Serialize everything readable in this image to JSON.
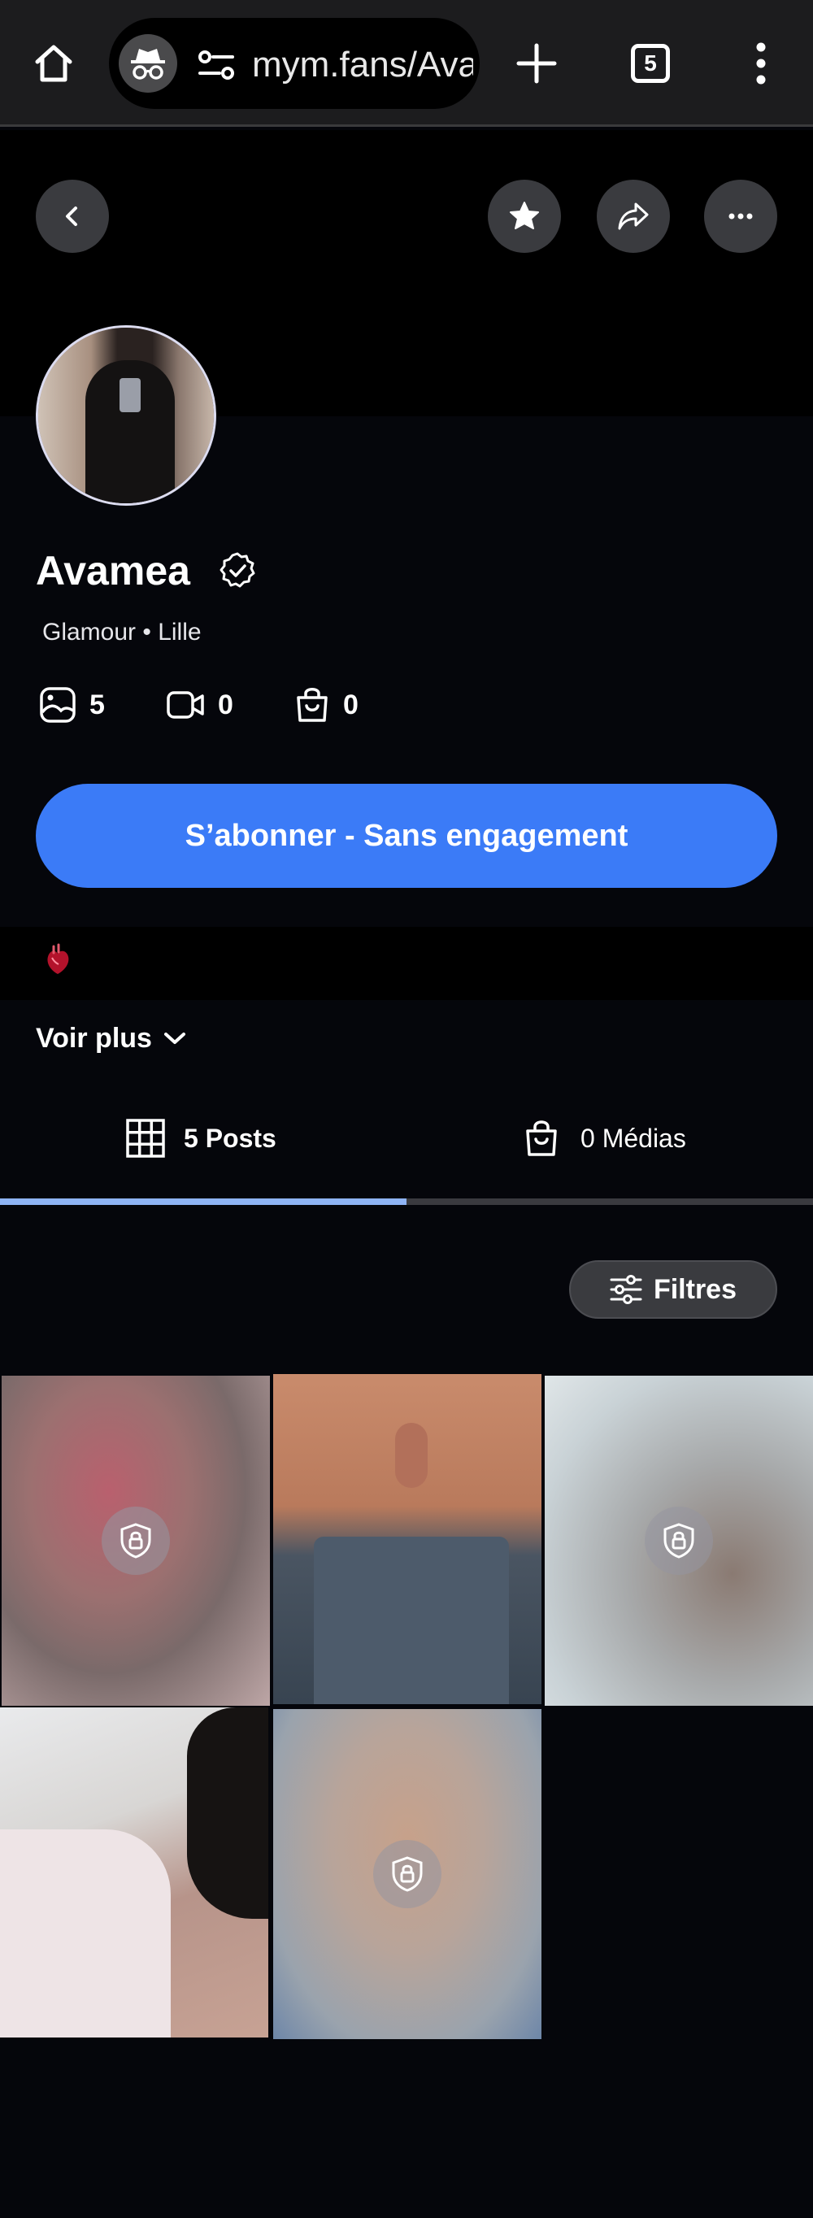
{
  "browser": {
    "url": "mym.fans/Avamea",
    "tab_count": "5"
  },
  "profile": {
    "name": "Avamea",
    "tagline": "Glamour • Lille",
    "stats": {
      "posts": "5",
      "videos": "0",
      "products": "0"
    },
    "subscribe_label": "S’abonner - Sans engagement",
    "bio_emoji": "anatomical-heart",
    "see_more_label": "Voir plus"
  },
  "tabs": [
    {
      "label": "5 Posts",
      "active": true
    },
    {
      "label": "0 Médias",
      "active": false
    }
  ],
  "filters_label": "Filtres",
  "grid": [
    {
      "locked": true
    },
    {
      "locked": false
    },
    {
      "locked": true
    },
    {
      "locked": false
    },
    {
      "locked": true
    }
  ],
  "colors": {
    "accent": "#3b7bf7",
    "background": "#05060b",
    "tab_indicator": "#8fb4f5"
  }
}
